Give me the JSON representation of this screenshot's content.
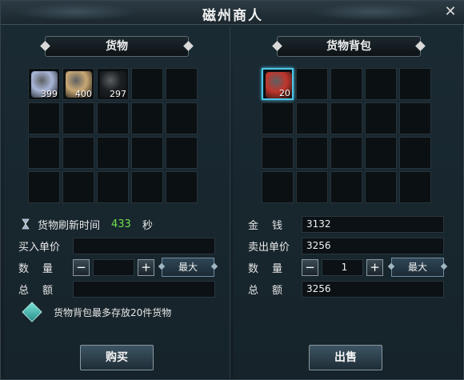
{
  "window": {
    "title": "磁州商人"
  },
  "close_glyph": "✕",
  "goods": {
    "header": "货物",
    "items": [
      {
        "icon": "blue-pouch-icon",
        "count": "399",
        "color": "#a9b7d8"
      },
      {
        "icon": "scroll-icon",
        "count": "400",
        "color": "#c9a874"
      },
      {
        "icon": "black-jar-icon",
        "count": "297",
        "color": "#1b1f23"
      }
    ],
    "refresh_label": "货物刷新时间",
    "refresh_value": "433",
    "refresh_unit": "秒",
    "unit_price_label": "买入单价",
    "unit_price_value": "",
    "qty_label": "数量",
    "qty_value": "",
    "total_label": "总额",
    "total_value": "",
    "max_label": "最大",
    "hint": "货物背包最多存放20件货物",
    "buy_label": "购买"
  },
  "bag": {
    "header": "货物背包",
    "items": [
      {
        "icon": "red-cloth-icon",
        "count": "20",
        "color": "#c0362c"
      }
    ],
    "money_label": "金钱",
    "money_value": "3132",
    "sell_price_label": "卖出单价",
    "sell_price_value": "3256",
    "qty_label": "数量",
    "qty_value": "1",
    "total_label": "总额",
    "total_value": "3256",
    "max_label": "最大",
    "sell_label": "出售"
  },
  "stepper": {
    "minus": "−",
    "plus": "+"
  }
}
